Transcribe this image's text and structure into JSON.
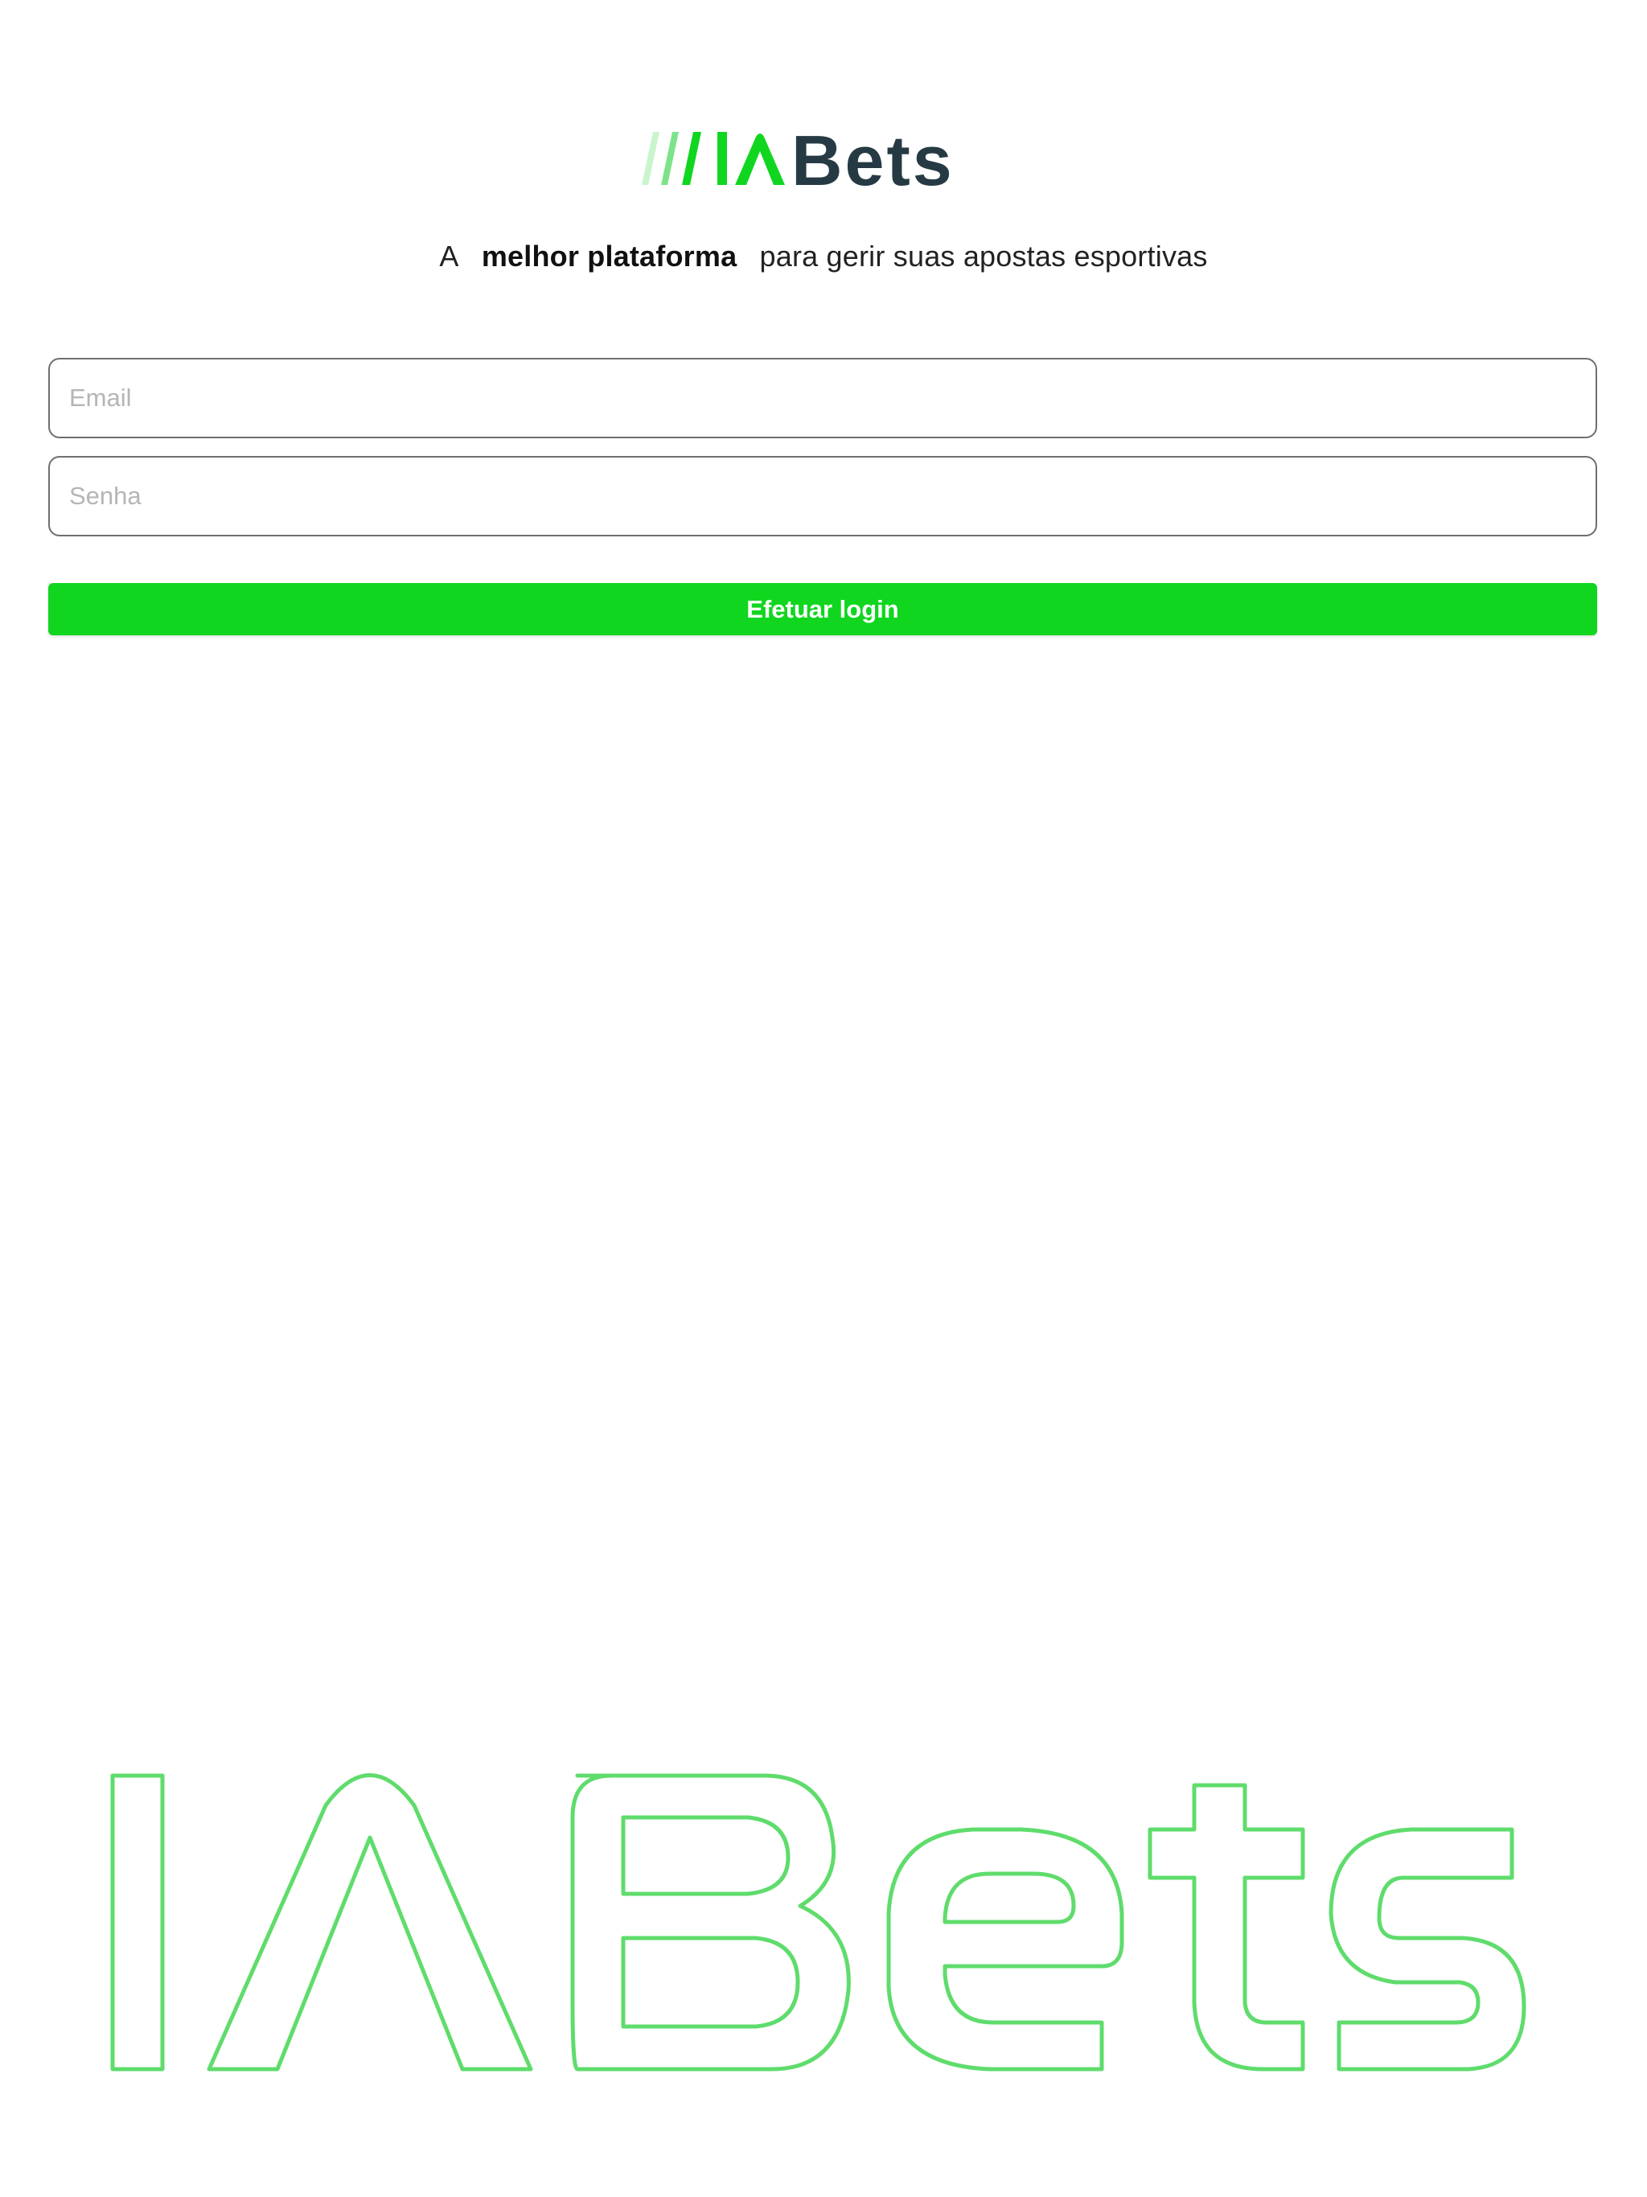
{
  "brand": {
    "name": "IABets",
    "accent_color": "#10d620",
    "dark_color": "#263a44"
  },
  "tagline": {
    "prefix": "A",
    "highlight": "melhor plataforma",
    "suffix": "para gerir suas apostas esportivas"
  },
  "form": {
    "email_placeholder": "Email",
    "password_placeholder": "Senha",
    "submit_label": "Efetuar login"
  }
}
